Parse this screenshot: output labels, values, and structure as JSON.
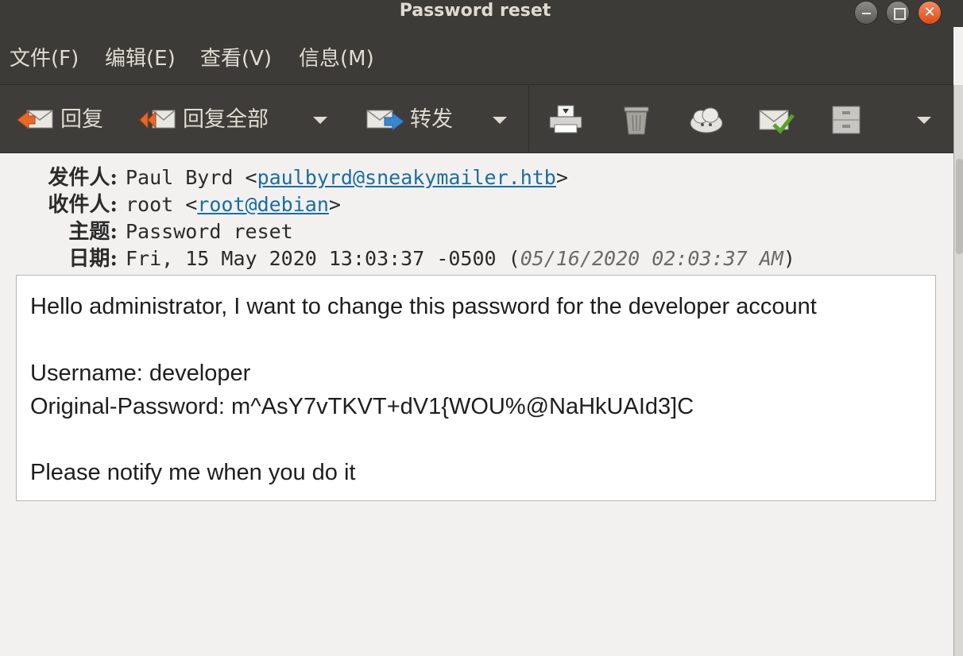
{
  "window": {
    "title": "Password reset"
  },
  "menu": [
    {
      "label": "文件(F)"
    },
    {
      "label": "编辑(E)"
    },
    {
      "label": "查看(V)"
    },
    {
      "label": "信息(M)"
    }
  ],
  "toolbar": {
    "reply_label": "回复",
    "reply_all_label": "回复全部",
    "forward_label": "转发",
    "icons": [
      "reply-icon",
      "reply-all-icon",
      "forward-icon",
      "print-icon",
      "trash-icon",
      "junk-icon",
      "mark-icon",
      "archive-icon"
    ]
  },
  "header": {
    "from_label": "发件人:",
    "from_name": "Paul Byrd <",
    "from_email": "paulbyrd@sneakymailer.htb",
    "from_suffix": ">",
    "to_label": "收件人:",
    "to_name": "root <",
    "to_email": "root@debian",
    "to_suffix": ">",
    "subject_label": "主题:",
    "subject": "Password reset",
    "date_label": "日期:",
    "date": "Fri, 15 May 2020 13:03:37 -0500 (",
    "date_local": "05/16/2020 02:03:37 AM",
    "date_suffix": ")"
  },
  "body": {
    "line1": "Hello administrator, I want to change this password for the developer account",
    "line2": "Username: developer",
    "line3": "Original-Password: m^AsY7vTKVT+dV1{WOU%@NaHkUAId3]C",
    "line4": "Please notify me when you do it"
  }
}
